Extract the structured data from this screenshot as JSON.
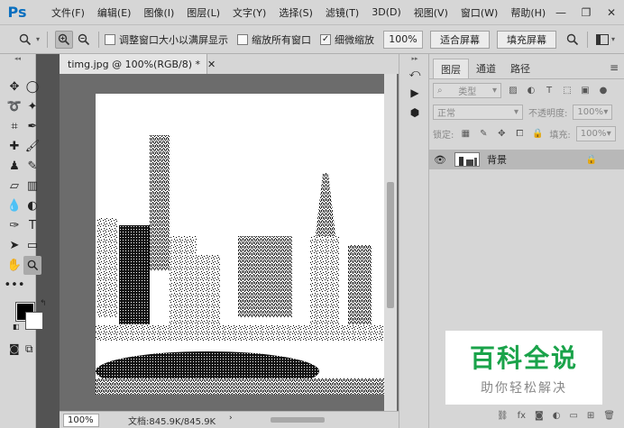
{
  "app": {
    "logo": "Ps"
  },
  "menu": [
    "文件(F)",
    "编辑(E)",
    "图像(I)",
    "图层(L)",
    "文字(Y)",
    "选择(S)",
    "滤镜(T)",
    "3D(D)",
    "视图(V)",
    "窗口(W)",
    "帮助(H)"
  ],
  "window_controls": {
    "minimize": "—",
    "restore": "❐",
    "close": "✕"
  },
  "options": {
    "resize_windows_label": "调整窗口大小以满屏显示",
    "resize_windows_checked": false,
    "zoom_all_label": "缩放所有窗口",
    "zoom_all_checked": false,
    "scrubby_zoom_label": "细微缩放",
    "scrubby_zoom_checked": true,
    "zoom_value": "100%",
    "fit_screen_label": "适合屏幕",
    "fill_screen_label": "填充屏幕"
  },
  "document": {
    "tab_title": "timg.jpg @ 100%(RGB/8) *",
    "zoom": "100%",
    "doc_info": "文档:845.9K/845.9K"
  },
  "layers_panel": {
    "tabs": [
      "图层",
      "通道",
      "路径"
    ],
    "filter_kind": "类型",
    "blend_mode": "正常",
    "opacity_label": "不透明度:",
    "opacity_value": "100%",
    "lock_label": "锁定:",
    "fill_label": "填充:",
    "fill_value": "100%",
    "layers": [
      {
        "name": "背景",
        "visible": true,
        "locked": true
      }
    ],
    "footer_icons": [
      "link-icon",
      "fx-icon",
      "mask-icon",
      "adjustment-icon",
      "group-icon",
      "new-layer-icon",
      "trash-icon"
    ]
  },
  "watermark": {
    "title": "百科全说",
    "subtitle": "助你轻松解决"
  },
  "colors": {
    "foreground": "#000000",
    "background": "#ffffff",
    "watermark_green": "#1aa34a"
  }
}
